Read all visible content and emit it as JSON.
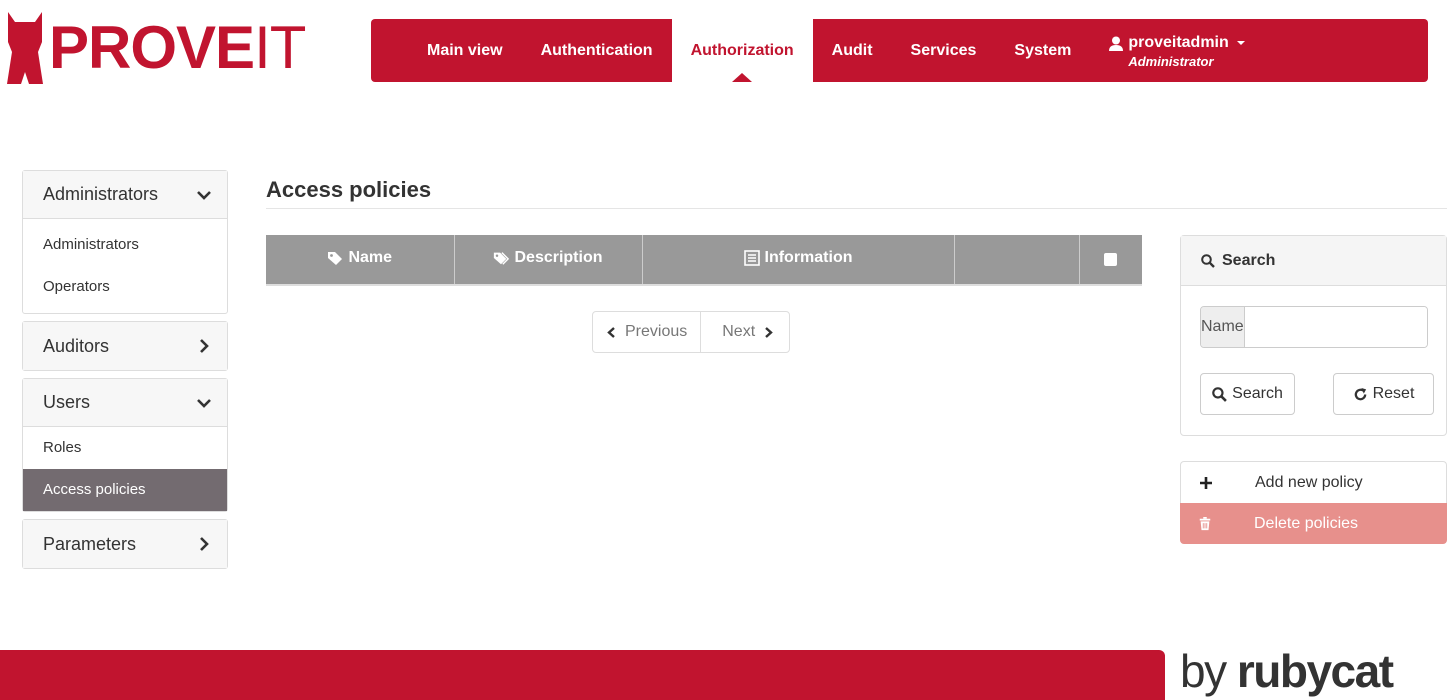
{
  "brand": {
    "logo_bold": "PROVE",
    "logo_thin": "IT",
    "footer_by": "by",
    "footer_name": "rubycat",
    "accent_color": "#c1142f"
  },
  "nav": {
    "items": [
      {
        "label": "Main view"
      },
      {
        "label": "Authentication"
      },
      {
        "label": "Authorization",
        "active": true
      },
      {
        "label": "Audit"
      },
      {
        "label": "Services"
      },
      {
        "label": "System"
      }
    ],
    "user": {
      "name": "proveitadmin",
      "role": "Administrator",
      "icon": "user-icon"
    }
  },
  "sidebar": {
    "groups": [
      {
        "label": "Administrators",
        "expanded": true,
        "items": [
          "Administrators",
          "Operators"
        ]
      },
      {
        "label": "Auditors",
        "expanded": false
      },
      {
        "label": "Users",
        "expanded": true,
        "items": [
          "Roles",
          "Access policies"
        ],
        "active_item": "Access policies"
      },
      {
        "label": "Parameters",
        "expanded": false
      }
    ]
  },
  "main": {
    "title": "Access policies",
    "table": {
      "columns": [
        {
          "label": "Name",
          "icon": "tag-icon"
        },
        {
          "label": "Description",
          "icon": "tags-icon"
        },
        {
          "label": "Information",
          "icon": "list-icon"
        },
        {
          "label": ""
        },
        {
          "label": "",
          "icon": "checkbox"
        }
      ],
      "rows": []
    },
    "pager": {
      "previous": "Previous",
      "next": "Next"
    }
  },
  "search": {
    "title": "Search",
    "name_label": "Name",
    "name_value": "",
    "search_button": "Search",
    "reset_button": "Reset"
  },
  "actions": {
    "add": "Add new policy",
    "delete": "Delete policies"
  }
}
